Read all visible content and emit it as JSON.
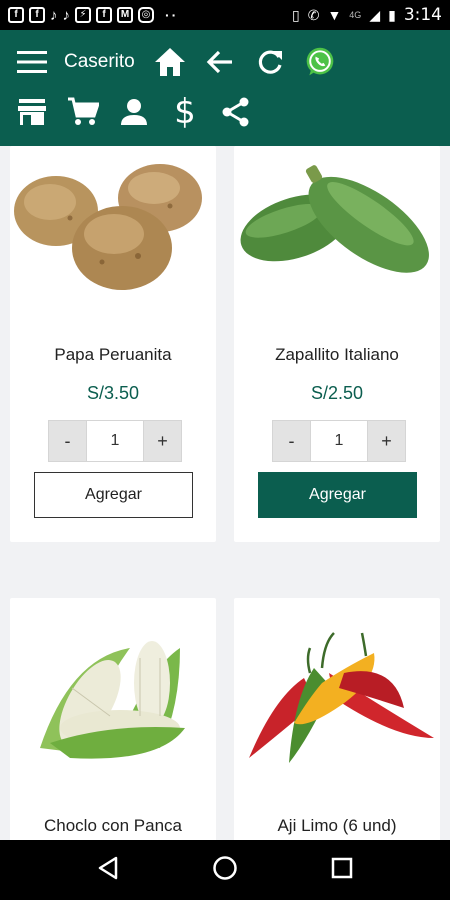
{
  "status_bar": {
    "time": "3:14",
    "network": "4G",
    "overflow_dots": "··",
    "notification_icons": [
      "facebook-icon",
      "facebook-icon",
      "tiktok-icon",
      "tiktok-icon",
      "messenger-icon",
      "facebook-icon",
      "gmail-icon",
      "instagram-icon"
    ]
  },
  "header": {
    "app_title": "Caserito",
    "background_color": "#0b5e4f",
    "row1_icons": [
      "menu-icon",
      "home-icon",
      "back-arrow-icon",
      "refresh-icon",
      "whatsapp-icon"
    ],
    "row2_icons": [
      "store-icon",
      "cart-icon",
      "user-icon",
      "dollar-icon",
      "share-icon"
    ]
  },
  "products": [
    {
      "name": "Papa Peruanita",
      "price": "S/3.50",
      "quantity": "1",
      "minus_label": "-",
      "plus_label": "+",
      "button_label": "Agregar",
      "button_style": "outline",
      "image": "potatoes"
    },
    {
      "name": "Zapallito Italiano",
      "price": "S/2.50",
      "quantity": "1",
      "minus_label": "-",
      "plus_label": "+",
      "button_label": "Agregar",
      "button_style": "filled",
      "image": "zucchini"
    },
    {
      "name": "Choclo con Panca",
      "image": "corn"
    },
    {
      "name": "Aji Limo (6 und)",
      "image": "chili-peppers"
    }
  ],
  "nav_bar": {
    "icons": [
      "back-triangle-icon",
      "home-circle-icon",
      "recents-square-icon"
    ]
  }
}
